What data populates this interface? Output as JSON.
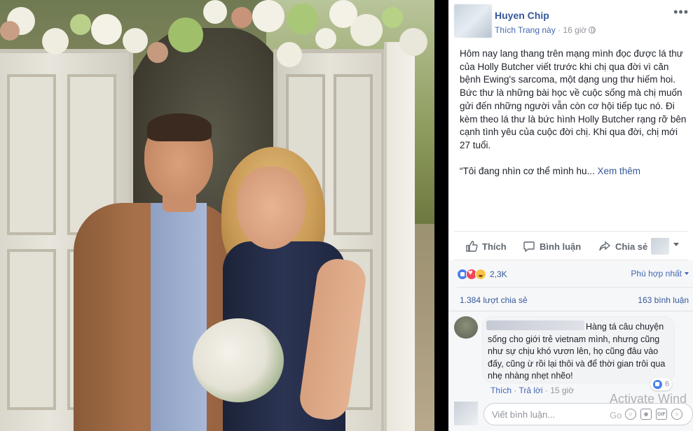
{
  "post": {
    "author": "Huyen Chip",
    "like_page": "Thích Trang này",
    "separator": " · ",
    "time": "16 giờ",
    "paragraph1": "Hôm nay lang thang trên mạng mình đọc được lá thư của Holly Butcher viết trước khi chị qua đời vì căn bệnh Ewing's sarcoma, một dạng ung thư hiếm hoi. Bức thư là những bài học về cuộc sống mà chị muốn gửi đến những người vẫn còn cơ hội tiếp tục nó. Đi kèm theo lá thư là bức hình Holly Butcher rạng rỡ bên cạnh tình yêu của cuộc đời chị. Khi qua đời, chị mới 27 tuổi.",
    "paragraph2": "“Tôi đang nhìn cơ thể mình hu...",
    "see_more": "Xem thêm"
  },
  "actions": {
    "like": "Thích",
    "comment": "Bình luận",
    "share": "Chia sẻ"
  },
  "stats": {
    "reactions_count": "2,3K",
    "sort_label": "Phù hợp nhất",
    "shares": "1.384 lượt chia sẻ",
    "comments": "163 bình luận"
  },
  "comment": {
    "text": "Hàng tá câu chuyện sống cho giới trẻ vietnam mình, nhưng cũng như sự chịu khó vươn lên, họ cũng đâu vào đấy, cũng ừ rồi lại thôi và để thời gian trôi qua nhẹ nhàng nhẹt nhẽo!",
    "like_label": "Thích",
    "reply_label": "Trả lời",
    "time": "15 giờ",
    "like_count": "6"
  },
  "reply": {
    "placeholder": "Viết bình luận..."
  },
  "overlay": {
    "activate_line1": "Activate Wind",
    "activate_line2": "Go"
  },
  "icons": [
    "thumbs-up-icon",
    "comment-icon",
    "share-arrow-icon",
    "globe-icon",
    "more-dots-icon",
    "emoji-icon",
    "camera-icon",
    "gif-icon",
    "sticker-icon"
  ],
  "colors": {
    "link": "#365899",
    "action_text": "#606770",
    "like_blue": "#4a7eec",
    "love_red": "#f0475a"
  }
}
